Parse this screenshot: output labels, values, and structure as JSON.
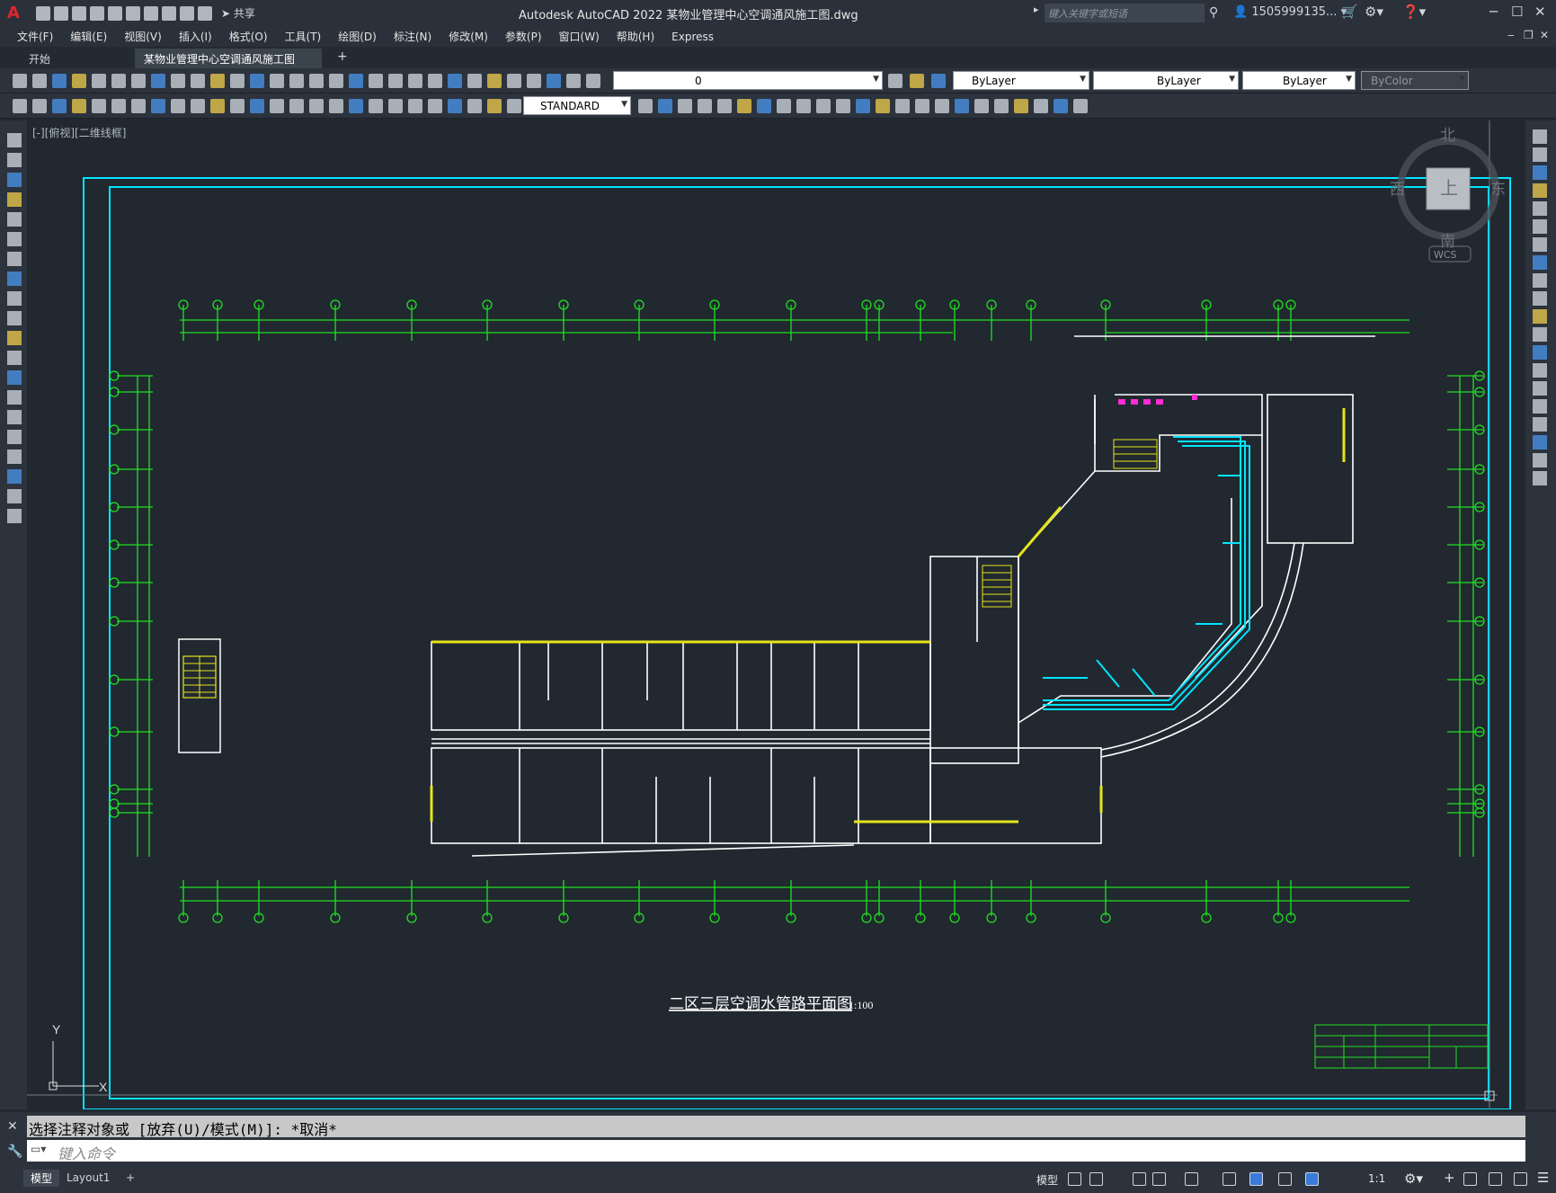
{
  "app": {
    "logo": "A",
    "title": "Autodesk AutoCAD 2022    某物业管理中心空调通风施工图.dwg",
    "share_label": "共享",
    "search_placeholder": "键入关键字或短语",
    "user": "1505999135..."
  },
  "menu": [
    "文件(F)",
    "编辑(E)",
    "视图(V)",
    "插入(I)",
    "格式(O)",
    "工具(T)",
    "绘图(D)",
    "标注(N)",
    "修改(M)",
    "参数(P)",
    "窗口(W)",
    "帮助(H)",
    "Express"
  ],
  "tabs": [
    {
      "label": "开始",
      "active": false
    },
    {
      "label": "某物业管理中心空调通风施工图*",
      "active": true
    }
  ],
  "layer_toolbar": {
    "layer_value": "0",
    "color_value": "ByLayer",
    "linetype_value": "ByLayer",
    "lineweight_value": "ByLayer",
    "plotstyle_value": "ByColor"
  },
  "style_toolbar": {
    "textstyle_value": "STANDARD"
  },
  "viewport": {
    "label": "[-][俯视][二维线框]"
  },
  "viewcube": {
    "north": "北",
    "south": "南",
    "east": "东",
    "west": "西",
    "top": "上",
    "wcs": "WCS"
  },
  "drawing": {
    "title": "二区三层空调水管路平面图",
    "scale": "1:100",
    "ucs_y": "Y",
    "ucs_x": "X"
  },
  "command": {
    "history": "选择注释对象或 [放弃(U)/模式(M)]: *取消*",
    "placeholder": "键入命令"
  },
  "status": {
    "layout_tabs": [
      "模型",
      "Layout1"
    ],
    "model_label": "模型",
    "scale": "1:1"
  },
  "colors": {
    "grid": "#21e021",
    "frame": "#00e5ff",
    "walls": "#ffffff",
    "hatch": "#e5e51a",
    "duct": "#00e5ff",
    "fixture": "#ff2bd6",
    "background": "#212830"
  }
}
